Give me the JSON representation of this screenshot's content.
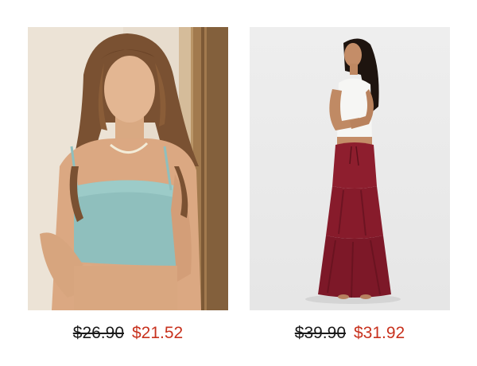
{
  "products": [
    {
      "image_icon": "product-photo-knit-cami-top",
      "original_price": "$26.90",
      "sale_price": "$21.52"
    },
    {
      "image_icon": "product-photo-tiered-maxi-skirt",
      "original_price": "$39.90",
      "sale_price": "$31.92"
    }
  ],
  "colors": {
    "sale": "#c8321e",
    "original": "#1a1a1a",
    "background": "#ffffff"
  }
}
